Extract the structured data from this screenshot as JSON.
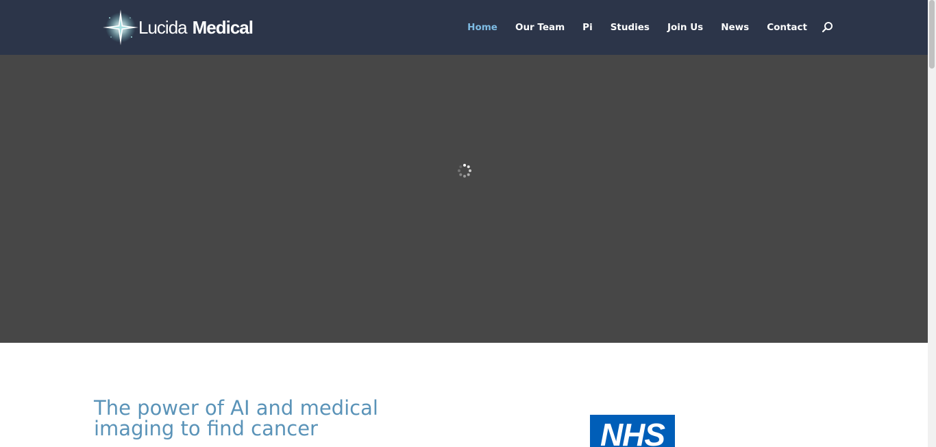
{
  "brand": {
    "name_light": "Lucida",
    "name_bold": "Medical"
  },
  "nav": {
    "items": [
      {
        "label": "Home",
        "active": true
      },
      {
        "label": "Our Team",
        "active": false
      },
      {
        "label": "Pi",
        "active": false
      },
      {
        "label": "Studies",
        "active": false
      },
      {
        "label": "Join Us",
        "active": false
      },
      {
        "label": "News",
        "active": false
      },
      {
        "label": "Contact",
        "active": false
      }
    ]
  },
  "content": {
    "headline": "The power of AI and medical imaging to find cancer",
    "partner_logo": "NHS"
  },
  "colors": {
    "header_bg": "#2c3549",
    "hero_bg": "#474747",
    "accent": "#7ebbe3",
    "headline": "#5a93b8",
    "nhs_blue": "#005eb8"
  },
  "icons": {
    "search": "search-icon",
    "spinner": "loading-spinner-icon",
    "logo": "star-logo-icon"
  }
}
